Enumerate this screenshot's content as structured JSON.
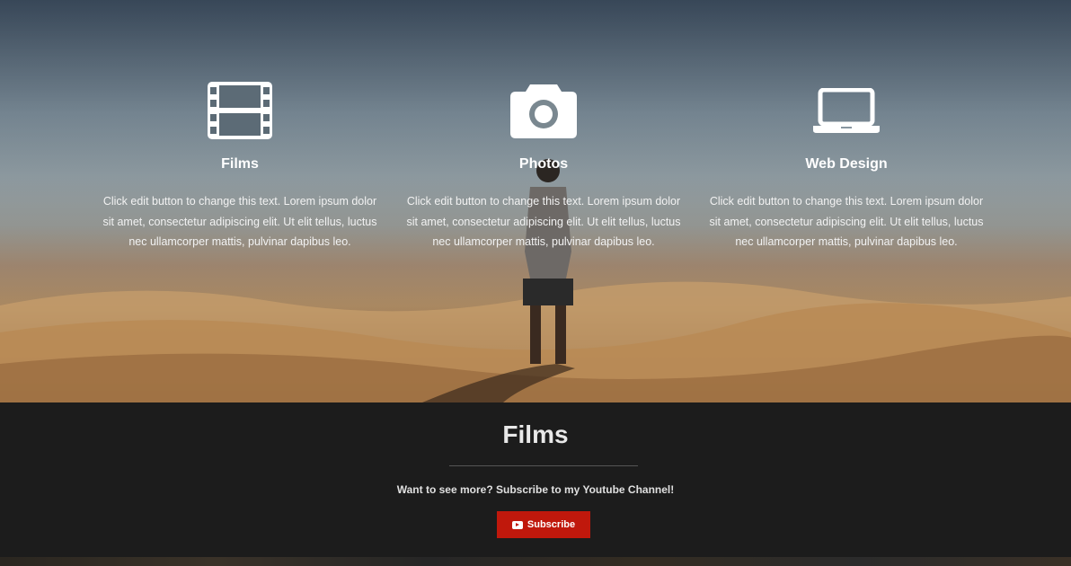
{
  "features": [
    {
      "icon": "film-icon",
      "title": "Films",
      "text": "Click edit button to change this text. Lorem ipsum dolor sit amet, consectetur adipiscing elit. Ut elit tellus, luctus nec ullamcorper mattis, pulvinar dapibus leo."
    },
    {
      "icon": "camera-icon",
      "title": "Photos",
      "text": "Click edit button to change this text. Lorem ipsum dolor sit amet, consectetur adipiscing elit. Ut elit tellus, luctus nec ullamcorper mattis, pulvinar dapibus leo."
    },
    {
      "icon": "laptop-icon",
      "title": "Web Design",
      "text": "Click edit button to change this text. Lorem ipsum dolor sit amet, consectetur adipiscing elit. Ut elit tellus, luctus nec ullamcorper mattis, pulvinar dapibus leo."
    }
  ],
  "films_section": {
    "title": "Films",
    "subtitle": "Want to see more? Subscribe to my Youtube Channel!",
    "button_label": "Subscribe",
    "button_icon": "youtube-icon",
    "button_color": "#c0180c"
  }
}
